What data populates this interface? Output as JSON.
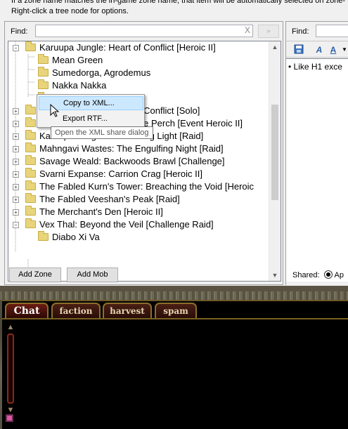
{
  "instructions": {
    "line1": "If a zone name matches the in-game zone name, that item will be automatically selected on zone-",
    "line2": "Right-click a tree node for options."
  },
  "left": {
    "find_label": "Find:",
    "find_value": "",
    "clear_glyph": "X",
    "go_glyph": "»",
    "tree": [
      {
        "label": "Karuupa Jungle: Heart of Conflict [Heroic II]",
        "level": 0,
        "expander": "−"
      },
      {
        "label": "Mean Green",
        "level": 1
      },
      {
        "label": "Sumedorga, Agrodemus",
        "level": 1
      },
      {
        "label": "Nakka Nakka",
        "level": 1
      },
      {
        "label": "",
        "level": 1
      },
      {
        "label": "Karuupa Jungle: Heart of Conflict [Solo]",
        "level": 0,
        "expander": "+"
      },
      {
        "label": "Karuupa Jungle: Skyshrine Perch [Event Heroic II]",
        "level": 0,
        "expander": "+"
      },
      {
        "label": "Karuupa Jungle: The Fading Light [Raid]",
        "level": 0,
        "expander": "+"
      },
      {
        "label": "Mahngavi Wastes: The Engulfing Night [Raid]",
        "level": 0,
        "expander": "+"
      },
      {
        "label": "Savage Weald: Backwoods Brawl [Challenge]",
        "level": 0,
        "expander": "+"
      },
      {
        "label": "Svarni Expanse: Carrion Crag [Heroic II]",
        "level": 0,
        "expander": "+"
      },
      {
        "label": "The Fabled Kurn's Tower: Breaching the Void [Heroic",
        "level": 0,
        "expander": "+"
      },
      {
        "label": "The Fabled Veeshan's Peak [Raid]",
        "level": 0,
        "expander": "+"
      },
      {
        "label": "The Merchant's Den [Heroic II]",
        "level": 0,
        "expander": "+"
      },
      {
        "label": "Vex Thal: Beyond the Veil [Challenge Raid]",
        "level": 0,
        "expander": "−"
      },
      {
        "label": "Diabo Xi Va",
        "level": 1
      }
    ],
    "add_zone": "Add Zone",
    "add_mob": "Add Mob"
  },
  "context_menu": {
    "items": [
      "Copy to XML...",
      "Export RTF..."
    ],
    "selected_index": 0,
    "tooltip": "Open the XML share dialog"
  },
  "right": {
    "find_label": "Find:",
    "editor_text": "• Like H1 exce",
    "shared_label": "Shared:",
    "shared_option": "Ap"
  },
  "chat": {
    "tabs": [
      "Chat",
      "faction",
      "harvest",
      "spam"
    ],
    "active_tab": 0
  },
  "colors": {
    "chat_tab_border": "#8d6e2c",
    "menu_highlight": "#cce8ff"
  }
}
